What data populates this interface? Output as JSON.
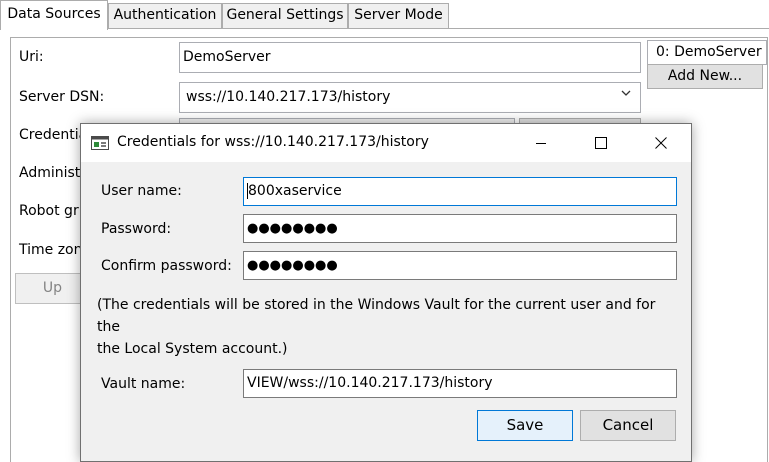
{
  "tabs": [
    {
      "label": "Data Sources",
      "active": true
    },
    {
      "label": "Authentication",
      "active": false
    },
    {
      "label": "General Settings",
      "active": false
    },
    {
      "label": "Server Mode",
      "active": false
    }
  ],
  "panel": {
    "uri_label": "Uri:",
    "uri_value": "DemoServer",
    "server_dsn_label": "Server DSN:",
    "server_dsn_value": "wss://10.140.217.173/history",
    "credentials_label": "Credentia",
    "administrators_label": "Administ",
    "robot_label": "Robot gr",
    "timezone_label": "Time zon",
    "up_button": "Up",
    "sources_list": [
      "0: DemoServer"
    ],
    "add_new_button": "Add New..."
  },
  "dialog": {
    "title": "Credentials for wss://10.140.217.173/history",
    "username_label": "User name:",
    "username_value": "800xaservice",
    "password_label": "Password:",
    "password_mask": "●●●●●●●●",
    "confirm_label": "Confirm password:",
    "confirm_mask": "●●●●●●●●",
    "info_line1": "(The credentials will be stored in the Windows Vault for the current user and for the",
    "info_line2": "the Local System account.)",
    "vault_label": "Vault name:",
    "vault_value": "VIEW/wss://10.140.217.173/history",
    "save_button": "Save",
    "cancel_button": "Cancel"
  },
  "colors": {
    "focus_border": "#0078d7",
    "button_face": "#e1e1e1",
    "dialog_background": "#f0f0f0"
  }
}
